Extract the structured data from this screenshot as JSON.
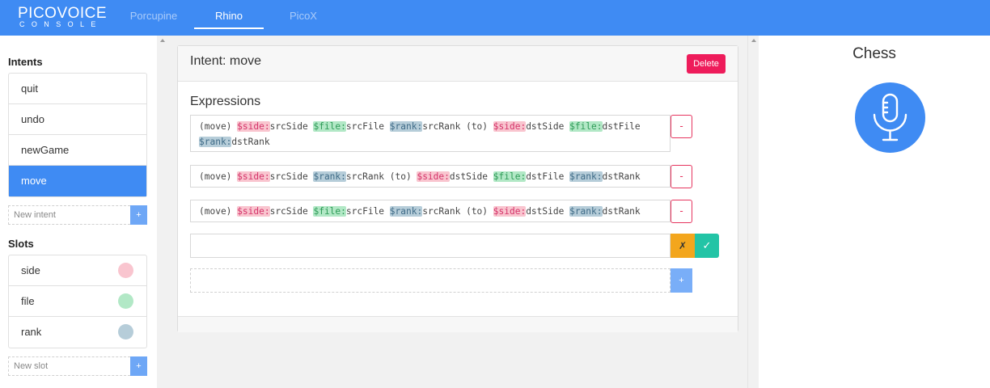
{
  "header": {
    "logo_main": "PICOVOICE",
    "logo_sub": "CONSOLE",
    "tabs": [
      {
        "label": "Porcupine",
        "active": false
      },
      {
        "label": "Rhino",
        "active": true
      },
      {
        "label": "PicoX",
        "active": false
      }
    ]
  },
  "sidebar": {
    "intents_title": "Intents",
    "intents": [
      {
        "label": "quit",
        "active": false
      },
      {
        "label": "undo",
        "active": false
      },
      {
        "label": "newGame",
        "active": false
      },
      {
        "label": "move",
        "active": true
      }
    ],
    "new_intent_placeholder": "New intent",
    "add_intent_label": "+",
    "slots_title": "Slots",
    "slots": [
      {
        "label": "side",
        "color": "#f9c5cf"
      },
      {
        "label": "file",
        "color": "#b2e8c6"
      },
      {
        "label": "rank",
        "color": "#b6cdd9"
      }
    ],
    "new_slot_placeholder": "New slot",
    "add_slot_label": "+"
  },
  "intent_editor": {
    "title": "Intent: move",
    "delete_label": "Delete",
    "expressions_title": "Expressions",
    "expressions": [
      {
        "parts": [
          {
            "t": "text",
            "v": "(move) "
          },
          {
            "t": "side",
            "v": "$side:"
          },
          {
            "t": "text",
            "v": "srcSide "
          },
          {
            "t": "file",
            "v": "$file:"
          },
          {
            "t": "text",
            "v": "srcFile "
          },
          {
            "t": "rank",
            "v": "$rank:"
          },
          {
            "t": "text",
            "v": "srcRank (to) "
          },
          {
            "t": "side",
            "v": "$side:"
          },
          {
            "t": "text",
            "v": "dstSide "
          },
          {
            "t": "file",
            "v": "$file:"
          },
          {
            "t": "text",
            "v": "dstFile "
          },
          {
            "t": "rank",
            "v": "$rank:"
          },
          {
            "t": "text",
            "v": "dstRank"
          }
        ]
      },
      {
        "parts": [
          {
            "t": "text",
            "v": "(move) "
          },
          {
            "t": "side",
            "v": "$side:"
          },
          {
            "t": "text",
            "v": "srcSide "
          },
          {
            "t": "rank",
            "v": "$rank:"
          },
          {
            "t": "text",
            "v": "srcRank (to) "
          },
          {
            "t": "side",
            "v": "$side:"
          },
          {
            "t": "text",
            "v": "dstSide "
          },
          {
            "t": "file",
            "v": "$file:"
          },
          {
            "t": "text",
            "v": "dstFile "
          },
          {
            "t": "rank",
            "v": "$rank:"
          },
          {
            "t": "text",
            "v": "dstRank"
          }
        ]
      },
      {
        "parts": [
          {
            "t": "text",
            "v": "(move) "
          },
          {
            "t": "side",
            "v": "$side:"
          },
          {
            "t": "text",
            "v": "srcSide "
          },
          {
            "t": "file",
            "v": "$file:"
          },
          {
            "t": "text",
            "v": "srcFile "
          },
          {
            "t": "rank",
            "v": "$rank:"
          },
          {
            "t": "text",
            "v": "srcRank (to) "
          },
          {
            "t": "side",
            "v": "$side:"
          },
          {
            "t": "text",
            "v": "dstSide "
          },
          {
            "t": "rank",
            "v": "$rank:"
          },
          {
            "t": "text",
            "v": "dstRank"
          }
        ]
      }
    ],
    "remove_label": "-",
    "new_expression_value": "",
    "cancel_label": "✗",
    "confirm_label": "✓",
    "add_expression_label": "+"
  },
  "context_panel": {
    "name": "Chess",
    "mic_icon": "microphone-icon",
    "accent": "#3f8bf3"
  }
}
